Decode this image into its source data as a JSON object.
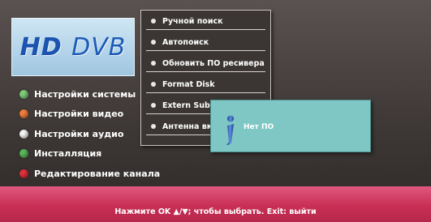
{
  "logo": {
    "brand_main": "HD",
    "brand_sub": "DVB"
  },
  "main_menu": [
    {
      "label": "Настройки системы",
      "color": "#7ecb7a"
    },
    {
      "label": "Настройки видео",
      "color": "#f07c3c"
    },
    {
      "label": "Настройки аудио",
      "color": "#f4f4f4"
    },
    {
      "label": "Инсталляция",
      "color": "#5ab65a"
    },
    {
      "label": "Редактирование канала",
      "color": "#e0303a"
    }
  ],
  "submenu": [
    {
      "label": "Ручной поиск"
    },
    {
      "label": "Автопоиск"
    },
    {
      "label": "Обновить ПО ресивера"
    },
    {
      "label": "Format Disk"
    },
    {
      "label": "Extern Subtitle"
    },
    {
      "label": "Антенна вкл."
    }
  ],
  "popup": {
    "message": "Нет ПО",
    "icon": "info-icon"
  },
  "footer": {
    "hint": "Нажмите OK ▲/▼; чтобы выбрать. Exit: выйти"
  },
  "colors": {
    "footer_bg": "#c92f55",
    "popup_bg": "#7fc7c4",
    "logo_text": "#1b53b0"
  }
}
